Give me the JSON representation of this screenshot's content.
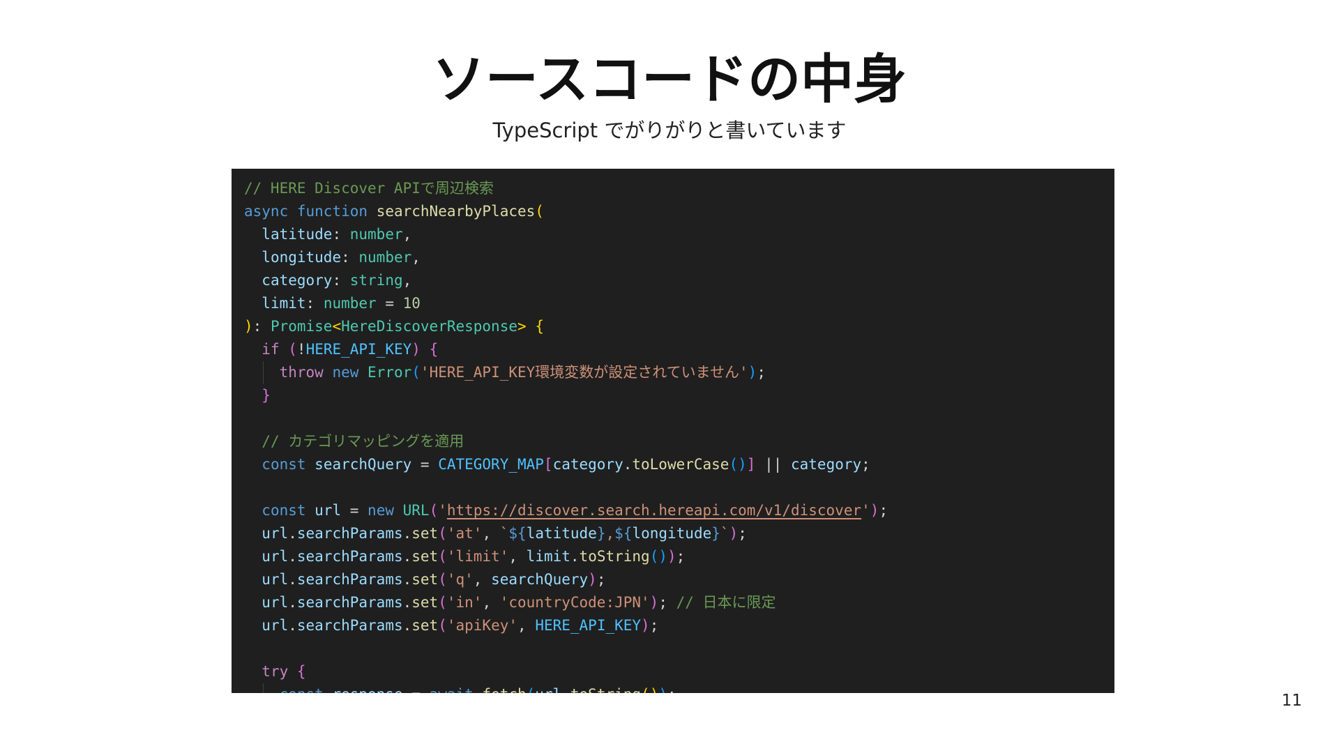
{
  "slide": {
    "title": "ソースコードの中身",
    "subtitle": "TypeScript でがりがりと書いています",
    "page_number": "11"
  },
  "colors": {
    "code_background": "#1f1f1f",
    "comment": "#6a9955",
    "keyword": "#569cd6",
    "control_keyword": "#c586c0",
    "function": "#dcdcaa",
    "variable": "#9cdcfe",
    "constant": "#4fc1ff",
    "type": "#4ec9b0",
    "string": "#ce9178",
    "number": "#b5cea8"
  },
  "code": {
    "language": "TypeScript",
    "lines": [
      "// HERE Discover APIで周辺検索",
      "async function searchNearbyPlaces(",
      "  latitude: number,",
      "  longitude: number,",
      "  category: string,",
      "  limit: number = 10",
      "): Promise<HereDiscoverResponse> {",
      "  if (!HERE_API_KEY) {",
      "    throw new Error('HERE_API_KEY環境変数が設定されていません');",
      "  }",
      "",
      "  // カテゴリマッピングを適用",
      "  const searchQuery = CATEGORY_MAP[category.toLowerCase()] || category;",
      "",
      "  const url = new URL('https://discover.search.hereapi.com/v1/discover');",
      "  url.searchParams.set('at', `${latitude},${longitude}`);",
      "  url.searchParams.set('limit', limit.toString());",
      "  url.searchParams.set('q', searchQuery);",
      "  url.searchParams.set('in', 'countryCode:JPN'); // 日本に限定",
      "  url.searchParams.set('apiKey', HERE_API_KEY);",
      "",
      "  try {",
      "    const response = await fetch(url.toString());"
    ]
  }
}
